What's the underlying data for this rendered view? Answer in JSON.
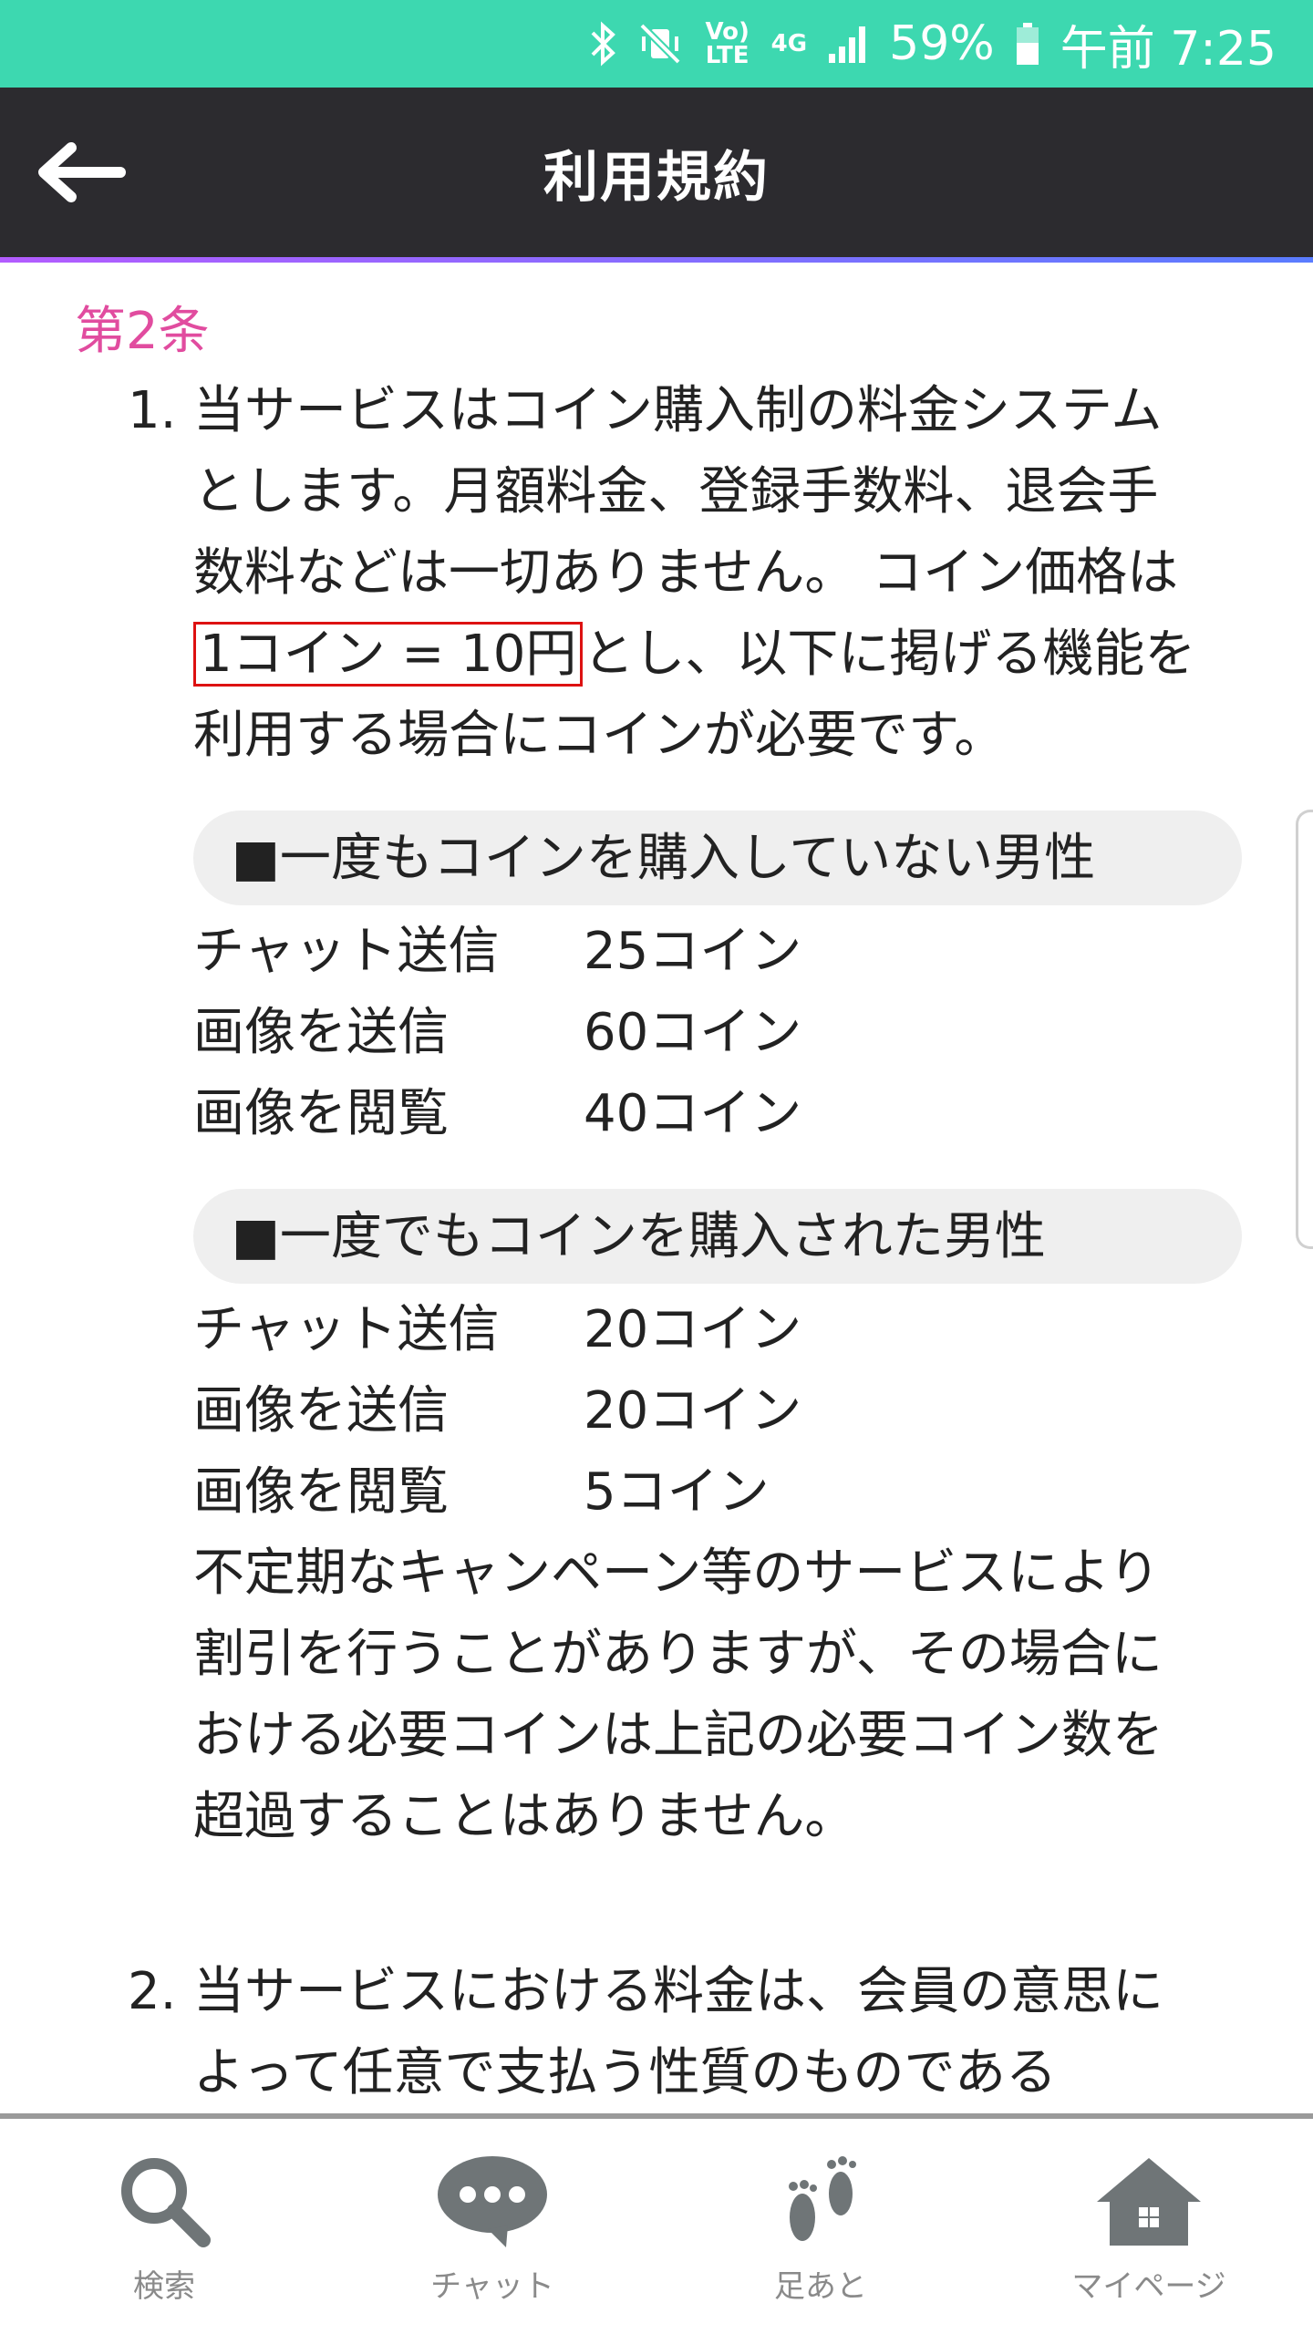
{
  "status_bar": {
    "lte_label": "Vo) LTE",
    "net_label": "4G",
    "battery": "59%",
    "time": "午前 7:25",
    "icons": [
      "bluetooth-icon",
      "vibrate-mute-icon",
      "volte-icon",
      "4g-icon",
      "signal-icon",
      "battery-icon"
    ]
  },
  "header": {
    "title": "利用規約",
    "back_icon": "back-arrow-icon",
    "accent_color": "#3dd8b0"
  },
  "content": {
    "article_title": "第2条",
    "item1": {
      "num": "1.",
      "text_before": "当サービスはコイン購入制の料金システムとします。月額料金、登録手数料、退会手数料などは一切ありません。 コイン価格は",
      "highlight": "1コイン = 10円",
      "text_after": "とし、以下に掲げる機能を利用する場合にコインが必要です。",
      "group1": {
        "heading": "■一度もコインを購入していない男性",
        "rows": [
          {
            "label": "チャット送信",
            "value": "25コイン"
          },
          {
            "label": "画像を送信",
            "value": "60コイン"
          },
          {
            "label": "画像を閲覧",
            "value": "40コイン"
          }
        ]
      },
      "group2": {
        "heading": "■一度でもコインを購入された男性",
        "rows": [
          {
            "label": "チャット送信",
            "value": "20コイン"
          },
          {
            "label": "画像を送信",
            "value": "20コイン"
          },
          {
            "label": "画像を閲覧",
            "value": "5コイン"
          }
        ]
      },
      "footnote": "不定期なキャンペーン等のサービスにより割引を行うことがありますが、その場合における必要コインは上記の必要コイン数を超過することはありません。"
    },
    "item2": {
      "num": "2.",
      "text": "当サービスにおける料金は、会員の意思によって任意で支払う性質のものである"
    }
  },
  "bottom_nav": {
    "items": [
      {
        "label": "検索",
        "icon": "search-icon"
      },
      {
        "label": "チャット",
        "icon": "chat-bubble-icon"
      },
      {
        "label": "足あと",
        "icon": "footprints-icon"
      },
      {
        "label": "マイページ",
        "icon": "home-icon"
      }
    ],
    "icon_color": "#6f7577"
  }
}
